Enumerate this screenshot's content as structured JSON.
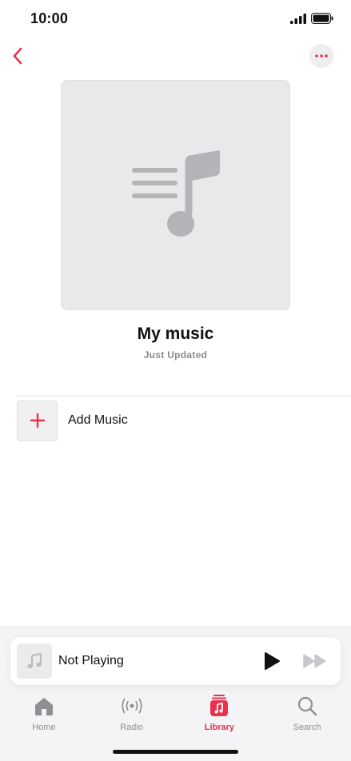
{
  "status_bar": {
    "time": "10:00",
    "signal_icon": "cellular-signal-icon",
    "battery_icon": "battery-full-icon"
  },
  "nav": {
    "back_icon": "chevron-left-icon",
    "more_icon": "ellipsis-icon"
  },
  "playlist": {
    "artwork_icon": "playlist-music-note-icon",
    "title": "My music",
    "subtitle": "Just Updated"
  },
  "add_music": {
    "icon": "plus-icon",
    "label": "Add Music"
  },
  "mini_player": {
    "artwork_icon": "music-note-icon",
    "label": "Not Playing",
    "play_icon": "play-icon",
    "forward_icon": "fast-forward-icon"
  },
  "tabs": [
    {
      "label": "Home",
      "icon": "home-icon",
      "active": false
    },
    {
      "label": "Radio",
      "icon": "radio-broadcast-icon",
      "active": false
    },
    {
      "label": "Library",
      "icon": "library-icon",
      "active": true
    },
    {
      "label": "Search",
      "icon": "search-icon",
      "active": false
    }
  ],
  "colors": {
    "accent": "#e8324b",
    "inactive": "#8e8e93",
    "artwork_bg": "#e9e9eb"
  }
}
